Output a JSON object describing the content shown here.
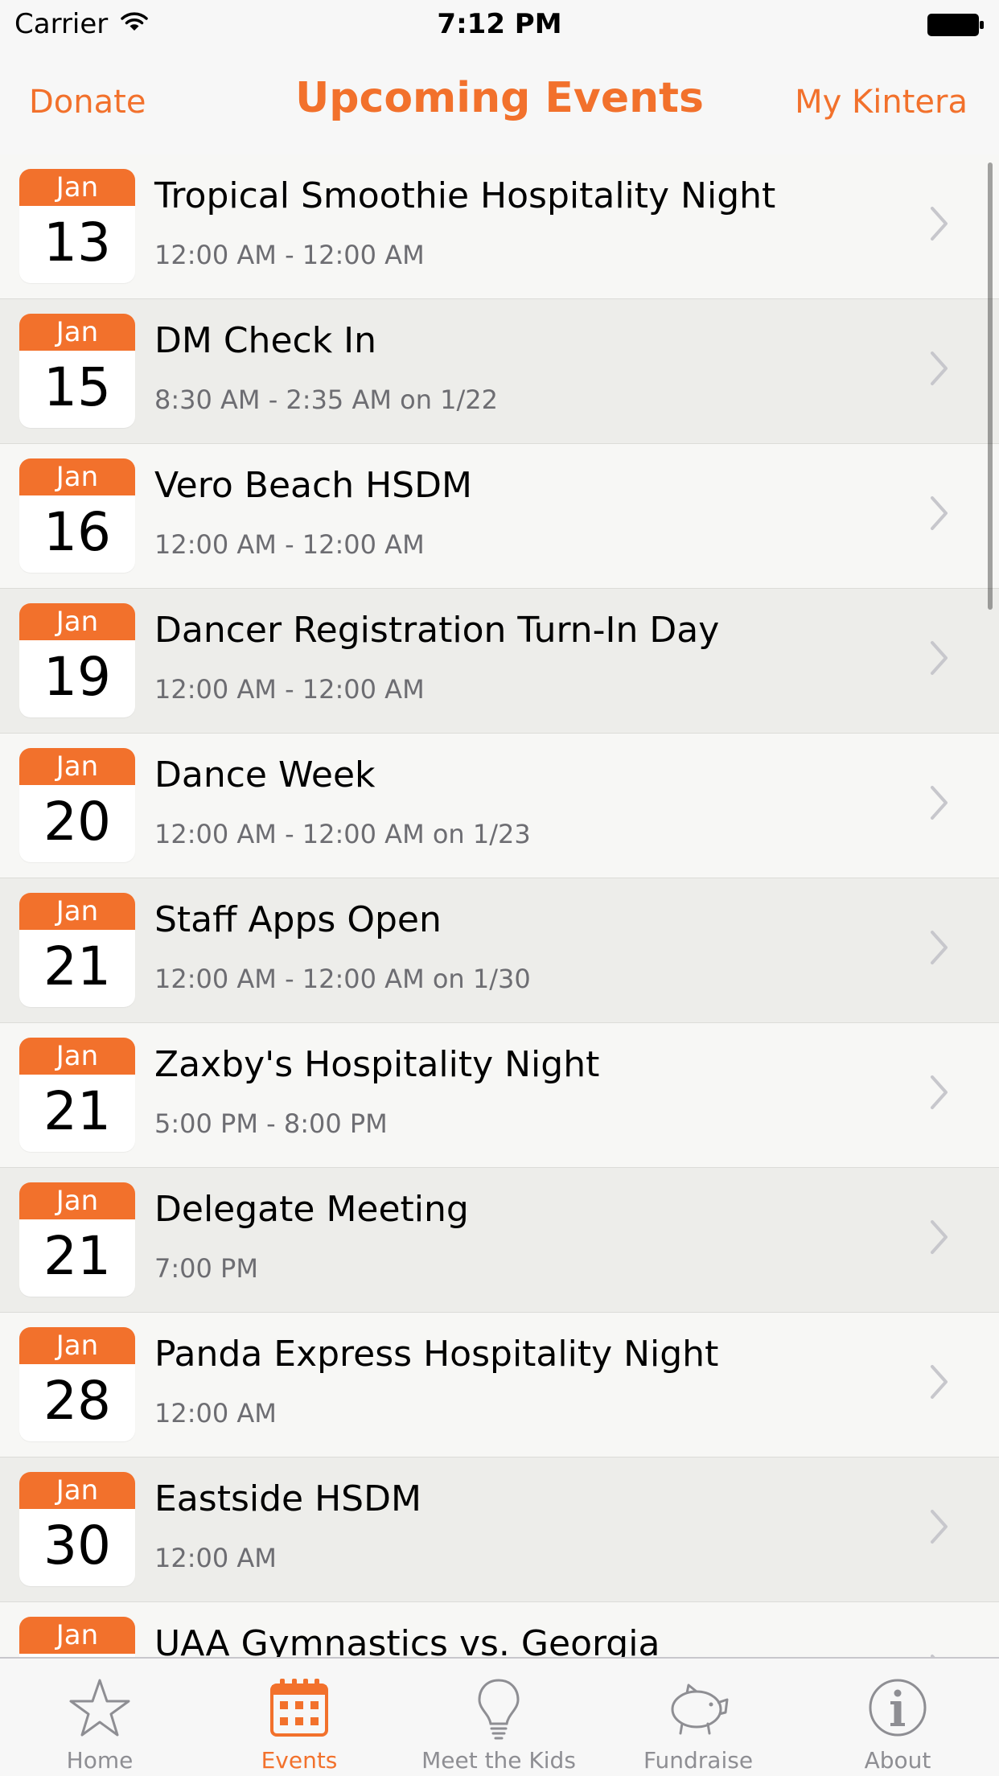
{
  "status_bar": {
    "carrier": "Carrier",
    "time": "7:12 PM"
  },
  "nav": {
    "left_label": "Donate",
    "title": "Upcoming Events",
    "right_label": "My Kintera"
  },
  "colors": {
    "accent": "#f2712c",
    "row_light": "#f7f7f5",
    "row_dark": "#ededea",
    "inactive_tab": "#8e8e93"
  },
  "events": [
    {
      "month": "Jan",
      "day": "13",
      "title": "Tropical Smoothie Hospitality Night",
      "time": "12:00 AM - 12:00 AM"
    },
    {
      "month": "Jan",
      "day": "15",
      "title": "DM Check In",
      "time": "8:30 AM - 2:35 AM on 1/22"
    },
    {
      "month": "Jan",
      "day": "16",
      "title": "Vero Beach HSDM",
      "time": "12:00 AM - 12:00 AM"
    },
    {
      "month": "Jan",
      "day": "19",
      "title": "Dancer Registration Turn-In Day",
      "time": "12:00 AM - 12:00 AM"
    },
    {
      "month": "Jan",
      "day": "20",
      "title": "Dance Week",
      "time": "12:00 AM - 12:00 AM on 1/23"
    },
    {
      "month": "Jan",
      "day": "21",
      "title": "Staff Apps Open",
      "time": "12:00 AM - 12:00 AM on 1/30"
    },
    {
      "month": "Jan",
      "day": "21",
      "title": "Zaxby's Hospitality Night",
      "time": "5:00 PM - 8:00 PM"
    },
    {
      "month": "Jan",
      "day": "21",
      "title": "Delegate Meeting",
      "time": "7:00 PM"
    },
    {
      "month": "Jan",
      "day": "28",
      "title": "Panda Express Hospitality Night",
      "time": "12:00 AM"
    },
    {
      "month": "Jan",
      "day": "30",
      "title": "Eastside HSDM",
      "time": "12:00 AM"
    },
    {
      "month": "Jan",
      "day": "",
      "title": "UAA Gymnastics vs. Georgia",
      "time": ""
    }
  ],
  "tabs": [
    {
      "label": "Home",
      "icon": "star-icon",
      "active": false
    },
    {
      "label": "Events",
      "icon": "calendar-icon",
      "active": true
    },
    {
      "label": "Meet the Kids",
      "icon": "lightbulb-icon",
      "active": false
    },
    {
      "label": "Fundraise",
      "icon": "piggy-bank-icon",
      "active": false
    },
    {
      "label": "About",
      "icon": "info-icon",
      "active": false
    }
  ]
}
